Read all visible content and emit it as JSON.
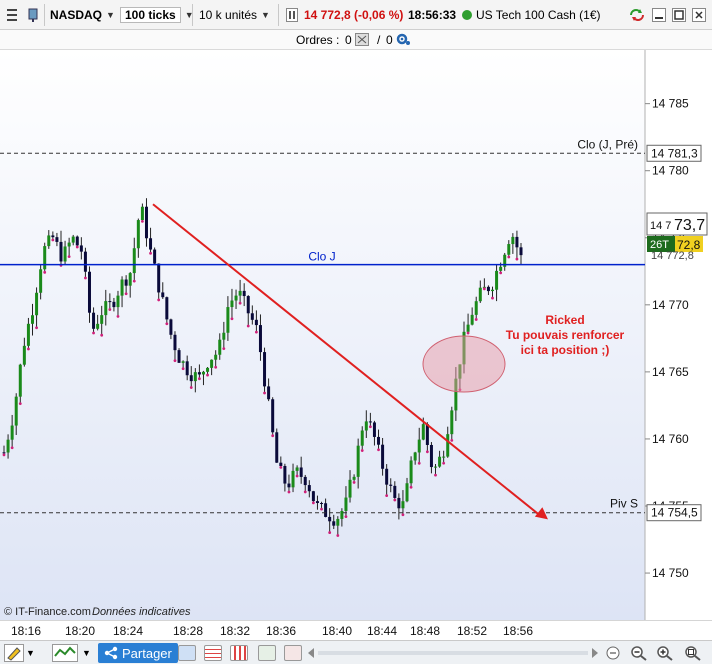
{
  "toolbar": {
    "symbol": "NASDAQ",
    "ticks": "100 ticks",
    "units": "10 k unités",
    "quote": "14 772,8 (-0,06 %)",
    "time": "18:56:33",
    "instrument": "US Tech 100 Cash (1€)"
  },
  "orders": {
    "label": "Ordres :",
    "buy_count": "0",
    "sell_sep": "/",
    "sell_count": "0"
  },
  "chart": {
    "price_labels": [
      "14 785",
      "14 780",
      "14 775",
      "14 770",
      "14 765",
      "14 760",
      "14 755",
      "14 750"
    ],
    "clo_prev_label": "Clo (J, Pré)",
    "clo_prev_value": "14 781,3",
    "clo_j_label": "Clo J",
    "current_value": "14 773,7",
    "current_big": "73,7",
    "current_small": "14 7",
    "bid_tag": "26T",
    "bid_value": "72,8",
    "ask_value": "14 772,8",
    "piv_label": "Piv S",
    "piv_value": "14 754,5",
    "annotation_line1": "Ricked",
    "annotation_line2": "Tu pouvais renforcer",
    "annotation_line3": "ici ta position ;)",
    "copyright": "© IT-Finance.com",
    "disclaimer": "Données indicatives",
    "colors": {
      "clo_j": "#0022cc",
      "arrow": "#e02020",
      "annotation": "#e02020",
      "bull": "#1a8a1a",
      "bear": "#0a0a3a"
    }
  },
  "chart_data": {
    "type": "candlestick",
    "ylim": [
      14746.5,
      14789
    ],
    "x_ticks": [
      "18:16",
      "18:20",
      "18:24",
      "18:28",
      "18:32",
      "18:36",
      "18:40",
      "18:44",
      "18:48",
      "18:52",
      "18:56"
    ],
    "y_ticks": [
      14785,
      14780,
      14775,
      14770,
      14765,
      14760,
      14755,
      14750
    ],
    "reference_lines": [
      {
        "name": "Clo (J, Pré)",
        "value": 14781.3,
        "style": "dashed"
      },
      {
        "name": "Clo J",
        "value": 14773.0,
        "style": "solid"
      },
      {
        "name": "Piv S",
        "value": 14754.5,
        "style": "dashed"
      }
    ],
    "path": [
      14759,
      14762,
      14767,
      14770,
      14774,
      14775,
      14773.5,
      14775,
      14774,
      14768,
      14769.5,
      14770,
      14771.5,
      14772.5,
      14777.5,
      14774,
      14771,
      14768,
      14766,
      14765,
      14764.5,
      14766,
      14766.5,
      14770,
      14771,
      14769.5,
      14768,
      14763,
      14758,
      14756.5,
      14757.5,
      14757,
      14755,
      14754.5,
      14754,
      14755,
      14758,
      14762,
      14760,
      14757.5,
      14755.5,
      14755,
      14759,
      14761,
      14757.5,
      14759,
      14763,
      14767,
      14769.5,
      14771,
      14771.5,
      14773.5,
      14775.5,
      14773.5
    ],
    "current_price": 14773.7,
    "bid": 14772.8
  },
  "bottom": {
    "share_label": "Partager"
  }
}
